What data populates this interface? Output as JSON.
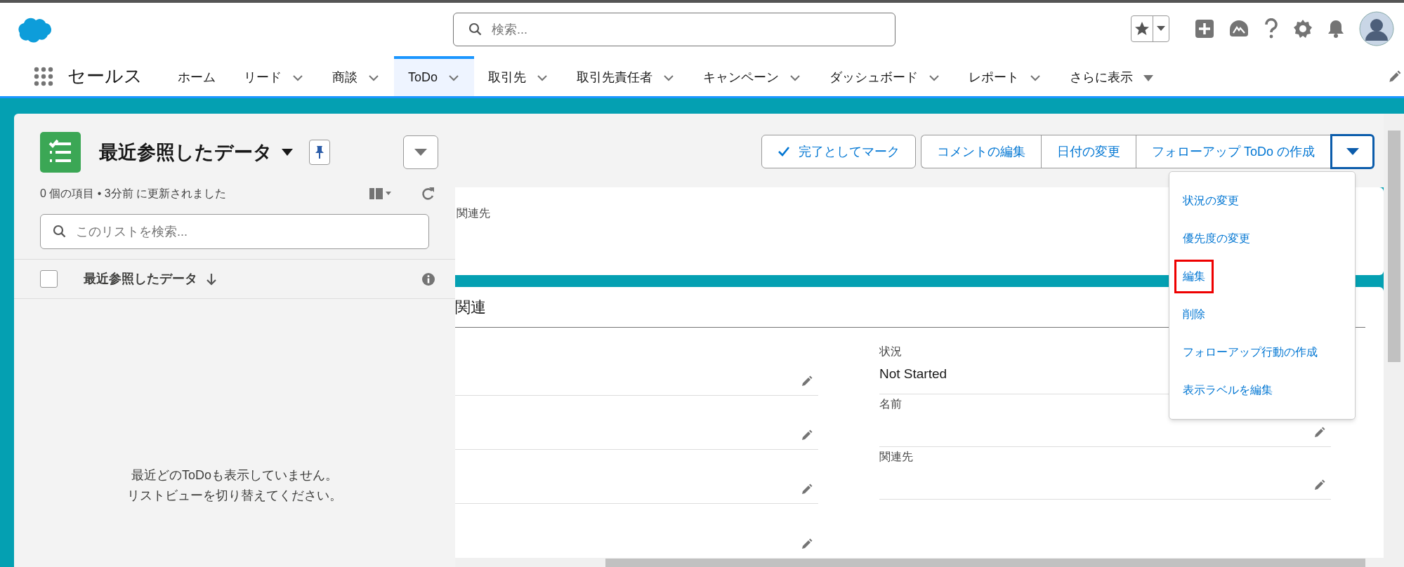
{
  "app_name": "セールス",
  "search": {
    "placeholder": "検索..."
  },
  "nav_tabs": [
    {
      "label": "ホーム",
      "menu": false,
      "selected": false,
      "kind": "tab"
    },
    {
      "label": "リード",
      "menu": true,
      "selected": false,
      "kind": "tab"
    },
    {
      "label": "商談",
      "menu": true,
      "selected": false,
      "kind": "tab"
    },
    {
      "label": "ToDo",
      "menu": true,
      "selected": true,
      "kind": "tab"
    },
    {
      "label": "取引先",
      "menu": true,
      "selected": false,
      "kind": "tab"
    },
    {
      "label": "取引先責任者",
      "menu": true,
      "selected": false,
      "kind": "tab"
    },
    {
      "label": "キャンペーン",
      "menu": true,
      "selected": false,
      "kind": "tab"
    },
    {
      "label": "ダッシュボード",
      "menu": true,
      "selected": false,
      "kind": "tab"
    },
    {
      "label": "レポート",
      "menu": true,
      "selected": false,
      "kind": "tab"
    },
    {
      "label": "さらに表示",
      "menu": true,
      "selected": false,
      "kind": "more"
    }
  ],
  "list_panel": {
    "title": "最近参照したデータ",
    "status": "0 個の項目 • 3分前 に更新されました",
    "search_placeholder": "このリストを検索...",
    "column_header": "最近参照したデータ",
    "select_all_checked": false,
    "empty_message": [
      "最近どのToDoも表示していません。",
      "リストビューを切り替えてください。"
    ]
  },
  "record": {
    "actions": [
      {
        "label": "完了としてマーク",
        "kind": "check"
      },
      {
        "label": "コメントの編集",
        "kind": "group"
      },
      {
        "label": "日付の変更",
        "kind": "group"
      },
      {
        "label": "フォローアップ ToDo の作成",
        "kind": "group"
      }
    ],
    "menu_open": true,
    "menu": [
      {
        "label": "状況の変更",
        "annotated": false
      },
      {
        "label": "優先度の変更",
        "annotated": false
      },
      {
        "label": "編集",
        "annotated": true
      },
      {
        "label": "削除",
        "annotated": false
      },
      {
        "label": "フォローアップ行動の作成",
        "annotated": false
      },
      {
        "label": "表示ラベルを編集",
        "annotated": false
      }
    ],
    "highlight_label": "関連先",
    "section_title": "関連",
    "fields_right": [
      {
        "label": "状況",
        "value": "Not Started",
        "editable": false
      },
      {
        "label": "名前",
        "editable": true
      },
      {
        "label": "関連先",
        "editable": true
      }
    ]
  }
}
